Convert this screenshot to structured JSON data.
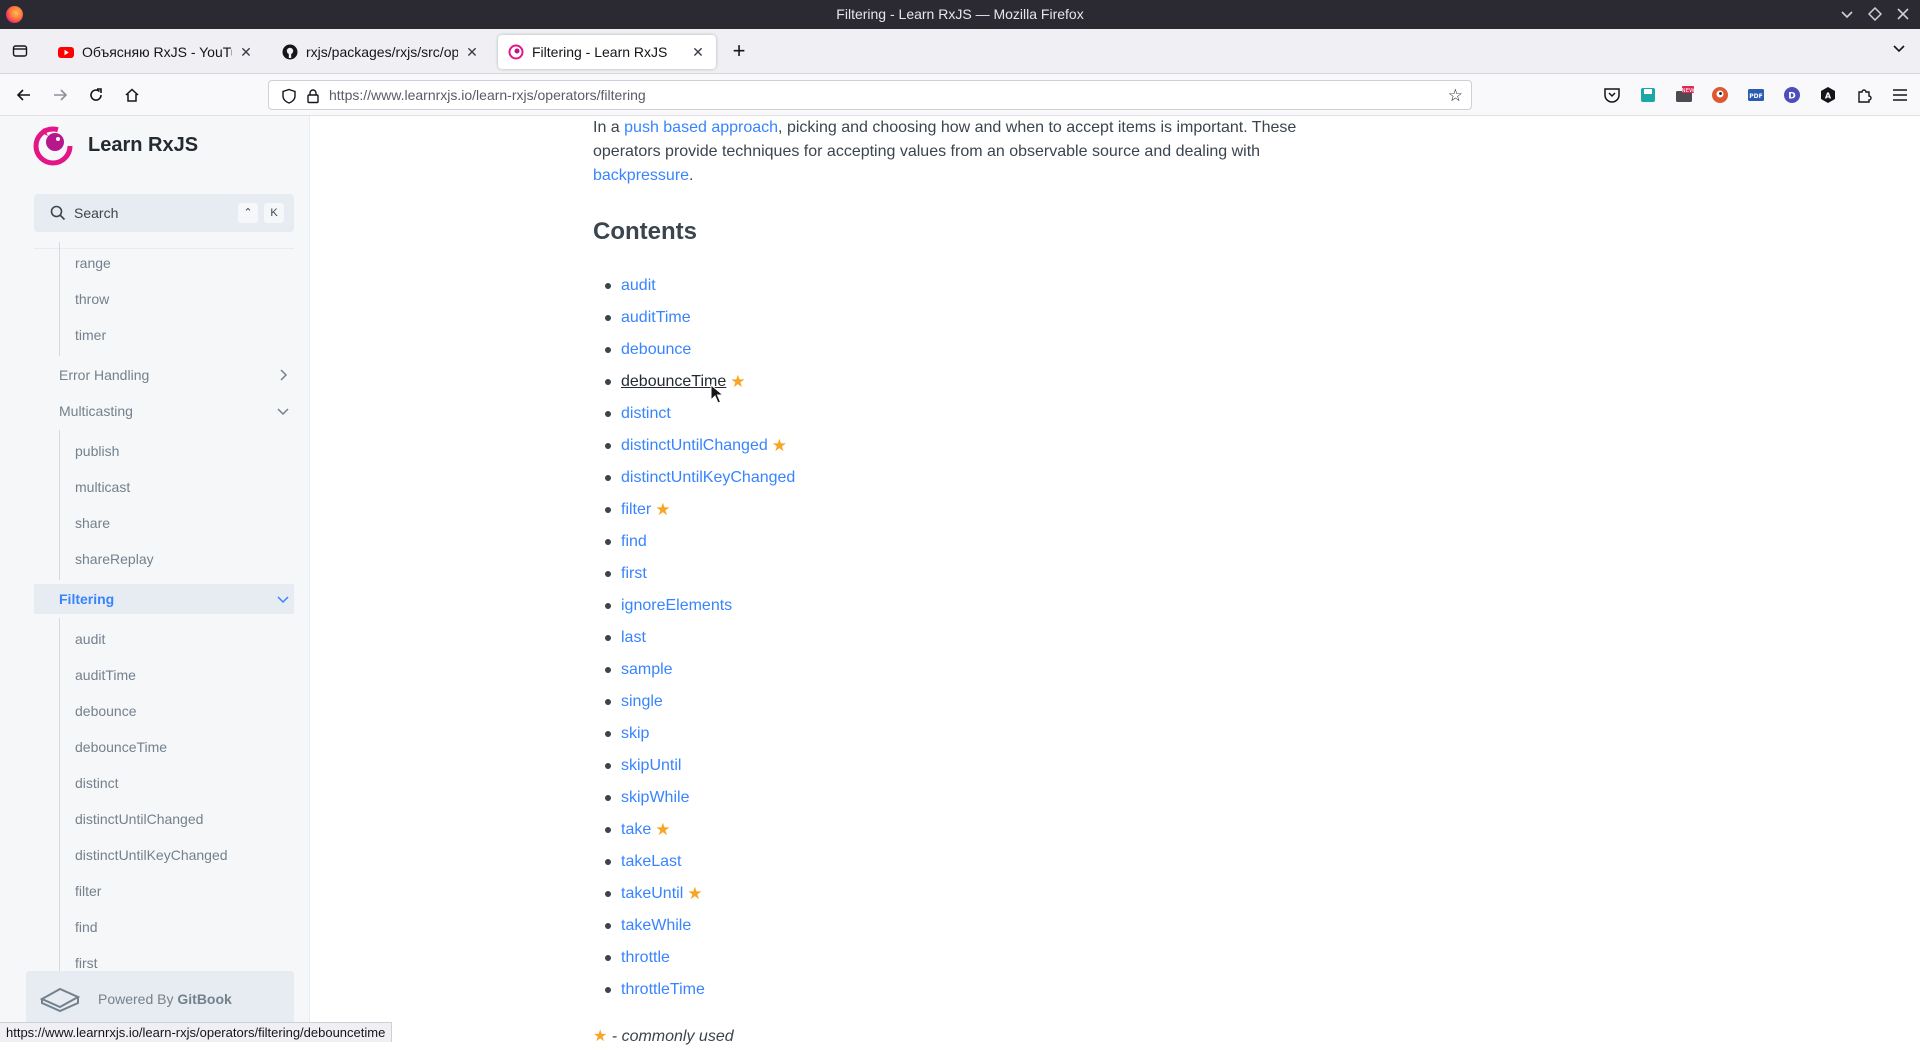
{
  "window": {
    "title": "Filtering - Learn RxJS — Mozilla Firefox"
  },
  "tabs": [
    {
      "label": "Объясняю RxJS - YouTube",
      "favicon": "youtube-icon"
    },
    {
      "label": "rxjs/packages/rxjs/src/operators",
      "favicon": "github-icon"
    },
    {
      "label": "Filtering - Learn RxJS",
      "favicon": "learnrxjs-icon",
      "active": true
    }
  ],
  "navbar": {
    "url": "https://www.learnrxjs.io/learn-rxjs/operators/filtering"
  },
  "sidebar": {
    "brand": "Learn RxJS",
    "search": {
      "label": "Search",
      "key1": "⌃",
      "key2": "K"
    },
    "items": [
      {
        "label": "range",
        "kind": "sub"
      },
      {
        "label": "throw",
        "kind": "sub"
      },
      {
        "label": "timer",
        "kind": "sub"
      },
      {
        "label": "Error Handling",
        "kind": "section",
        "chevron": "chevron-right-icon"
      },
      {
        "label": "Multicasting",
        "kind": "section",
        "chevron": "chevron-down-icon"
      },
      {
        "label": "publish",
        "kind": "sub"
      },
      {
        "label": "multicast",
        "kind": "sub"
      },
      {
        "label": "share",
        "kind": "sub"
      },
      {
        "label": "shareReplay",
        "kind": "sub"
      },
      {
        "label": "Filtering",
        "kind": "active",
        "chevron": "chevron-down-icon"
      },
      {
        "label": "audit",
        "kind": "sub"
      },
      {
        "label": "auditTime",
        "kind": "sub"
      },
      {
        "label": "debounce",
        "kind": "sub"
      },
      {
        "label": "debounceTime",
        "kind": "sub"
      },
      {
        "label": "distinct",
        "kind": "sub"
      },
      {
        "label": "distinctUntilChanged",
        "kind": "sub"
      },
      {
        "label": "distinctUntilKeyChanged",
        "kind": "sub"
      },
      {
        "label": "filter",
        "kind": "sub"
      },
      {
        "label": "find",
        "kind": "sub"
      },
      {
        "label": "first",
        "kind": "sub"
      }
    ],
    "powered_by": {
      "prefix": "Powered By ",
      "brand": "GitBook"
    }
  },
  "main": {
    "intro": {
      "p1": "In a ",
      "link1": "push based approach",
      "p2": ", picking and choosing how and when to accept items is important. These operators provide techniques for accepting values from an observable source and dealing with ",
      "link2": "backpressure",
      "p3": "."
    },
    "contents_heading": "Contents",
    "operators": [
      {
        "name": "audit",
        "star": false
      },
      {
        "name": "auditTime",
        "star": false
      },
      {
        "name": "debounce",
        "star": false
      },
      {
        "name": "debounceTime",
        "star": true,
        "hover": true
      },
      {
        "name": "distinct",
        "star": false
      },
      {
        "name": "distinctUntilChanged",
        "star": true
      },
      {
        "name": "distinctUntilKeyChanged",
        "star": false
      },
      {
        "name": "filter",
        "star": true
      },
      {
        "name": "find",
        "star": false
      },
      {
        "name": "first",
        "star": false
      },
      {
        "name": "ignoreElements",
        "star": false
      },
      {
        "name": "last",
        "star": false
      },
      {
        "name": "sample",
        "star": false
      },
      {
        "name": "single",
        "star": false
      },
      {
        "name": "skip",
        "star": false
      },
      {
        "name": "skipUntil",
        "star": false
      },
      {
        "name": "skipWhile",
        "star": false
      },
      {
        "name": "take",
        "star": true
      },
      {
        "name": "takeLast",
        "star": false
      },
      {
        "name": "takeUntil",
        "star": true
      },
      {
        "name": "takeWhile",
        "star": false
      },
      {
        "name": "throttle",
        "star": false
      },
      {
        "name": "throttleTime",
        "star": false
      }
    ],
    "footnote": {
      "star": "★",
      "text": " - commonly used"
    }
  },
  "status_url": "https://www.learnrxjs.io/learn-rxjs/operators/filtering/debouncetime",
  "colors": {
    "link": "#3884ff",
    "star": "#f6a623",
    "sidebar_bg": "#f5f7f9"
  }
}
